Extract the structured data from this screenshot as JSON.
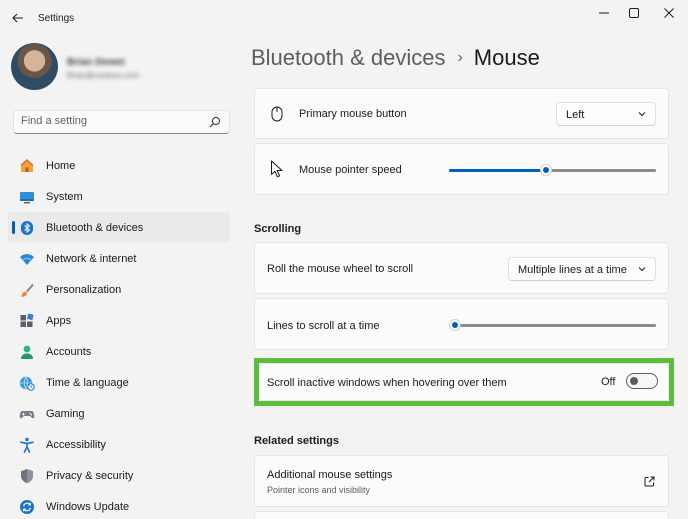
{
  "window": {
    "title": "Settings"
  },
  "profile": {
    "name": "Brian Dewet",
    "email": "Brian@contoso.com"
  },
  "search": {
    "placeholder": "Find a setting"
  },
  "nav": {
    "items": [
      {
        "label": "Home",
        "icon": "home-icon"
      },
      {
        "label": "System",
        "icon": "system-icon"
      },
      {
        "label": "Bluetooth & devices",
        "icon": "bluetooth-icon",
        "active": true
      },
      {
        "label": "Network & internet",
        "icon": "wifi-icon"
      },
      {
        "label": "Personalization",
        "icon": "brush-icon"
      },
      {
        "label": "Apps",
        "icon": "apps-icon"
      },
      {
        "label": "Accounts",
        "icon": "accounts-icon"
      },
      {
        "label": "Time & language",
        "icon": "globe-clock-icon"
      },
      {
        "label": "Gaming",
        "icon": "gamepad-icon"
      },
      {
        "label": "Accessibility",
        "icon": "accessibility-icon"
      },
      {
        "label": "Privacy & security",
        "icon": "shield-icon"
      },
      {
        "label": "Windows Update",
        "icon": "update-icon"
      }
    ]
  },
  "header": {
    "parent": "Bluetooth & devices",
    "separator": "›",
    "current": "Mouse"
  },
  "settings": {
    "primary_button": {
      "label": "Primary mouse button",
      "value": "Left"
    },
    "pointer_speed": {
      "label": "Mouse pointer speed",
      "level": 0.47
    },
    "scrolling_heading": "Scrolling",
    "roll_wheel": {
      "label": "Roll the mouse wheel to scroll",
      "value": "Multiple lines at a time"
    },
    "lines_to_scroll": {
      "label": "Lines to scroll at a time",
      "level": 0.03
    },
    "scroll_inactive": {
      "label": "Scroll inactive windows when hovering over them",
      "state": "Off"
    },
    "related_heading": "Related settings",
    "additional": {
      "label": "Additional mouse settings",
      "sub": "Pointer icons and visibility"
    }
  },
  "colors": {
    "accent": "#005fb8",
    "highlight": "#5cbd3e"
  }
}
